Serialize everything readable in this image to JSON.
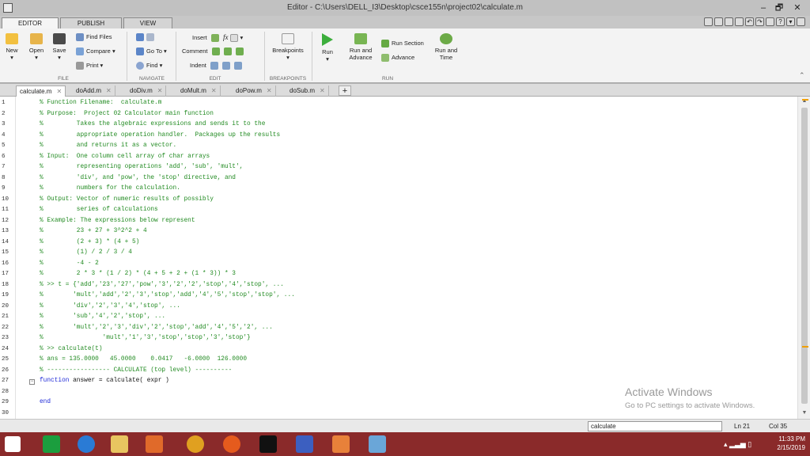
{
  "window": {
    "title": "Editor - C:\\Users\\DELL_I3\\Desktop\\csce155n\\project02\\calculate.m",
    "min": "–",
    "max": "🗗",
    "close": "✕"
  },
  "ribbon_tabs": [
    "EDITOR",
    "PUBLISH",
    "VIEW"
  ],
  "ribbon": {
    "new": "New",
    "open": "Open",
    "save": "Save",
    "find_files": "Find Files",
    "compare": "Compare",
    "print": "Print",
    "go_to": "Go To",
    "find": "Find",
    "insert": "Insert",
    "comment": "Comment",
    "indent": "Indent",
    "breakpoints": "Breakpoints",
    "run": "Run",
    "run_and_advance": "Run and Advance",
    "run_section": "Run Section",
    "advance": "Advance",
    "run_and_time": "Run and Time",
    "sections": [
      "FILE",
      "NAVIGATE",
      "EDIT",
      "BREAKPOINTS",
      "RUN"
    ]
  },
  "file_tabs": [
    "calculate.m",
    "doAdd.m",
    "doDiv.m",
    "doMult.m",
    "doPow.m",
    "doSub.m"
  ],
  "code_lines": [
    "% Function Filename:  calculate.m",
    "% Purpose:  Project 02 Calculator main function",
    "%         Takes the algebraic expressions and sends it to the",
    "%         appropriate operation handler.  Packages up the results",
    "%         and returns it as a vector.",
    "% Input:  One column cell array of char arrays",
    "%         representing operations 'add', 'sub', 'mult',",
    "%         'div', and 'pow', the 'stop' directive, and",
    "%         numbers for the calculation.",
    "% Output: Vector of numeric results of possibly",
    "%         series of calculations",
    "% Example: The expressions below represent",
    "%         23 + 27 + 3^2^2 + 4",
    "%         (2 + 3) * (4 + 5)",
    "%         (1) / 2 / 3 / 4",
    "%         -4 - 2",
    "%         2 * 3 * (1 / 2) * (4 + 5 + 2 + (1 * 3)) * 3",
    "% >> t = {'add','23','27','pow','3','2','2','stop','4','stop', ...",
    "%        'mult','add','2','3','stop','add','4','5','stop','stop', ...",
    "%        'div','2','3','4','stop', ...",
    "%        'sub','4','2','stop', ...",
    "%        'mult','2','3','div','2','stop','add','4','5','2', ...",
    "%                'mult','1','3','stop','stop','3','stop'}",
    "% >> calculate(t)",
    "% ans = 135.0000   45.0000    0.0417   -6.0000  126.0000",
    "% ----------------- CALCULATE (top level) ----------",
    "function answer = calculate( expr )",
    "",
    "end",
    ""
  ],
  "line_numbers": [
    "1",
    "2",
    "3",
    "4",
    "5",
    "6",
    "7",
    "8",
    "9",
    "10",
    "11",
    "12",
    "13",
    "14",
    "15",
    "16",
    "17",
    "18",
    "19",
    "20",
    "21",
    "22",
    "23",
    "24",
    "25",
    "26",
    "27",
    "28",
    "29",
    "30"
  ],
  "watermark": {
    "line1": "Activate Windows",
    "line2": "Go to PC settings to activate Windows."
  },
  "status": {
    "function_name": "calculate",
    "ln": "Ln  21",
    "col": "Col  35"
  },
  "taskbar": {
    "time": "11:33 PM",
    "date": "2/15/2019"
  },
  "colors": {
    "comment": "#228b22",
    "keyword": "#1f2ad8",
    "taskbar": "#8a2a2a"
  }
}
